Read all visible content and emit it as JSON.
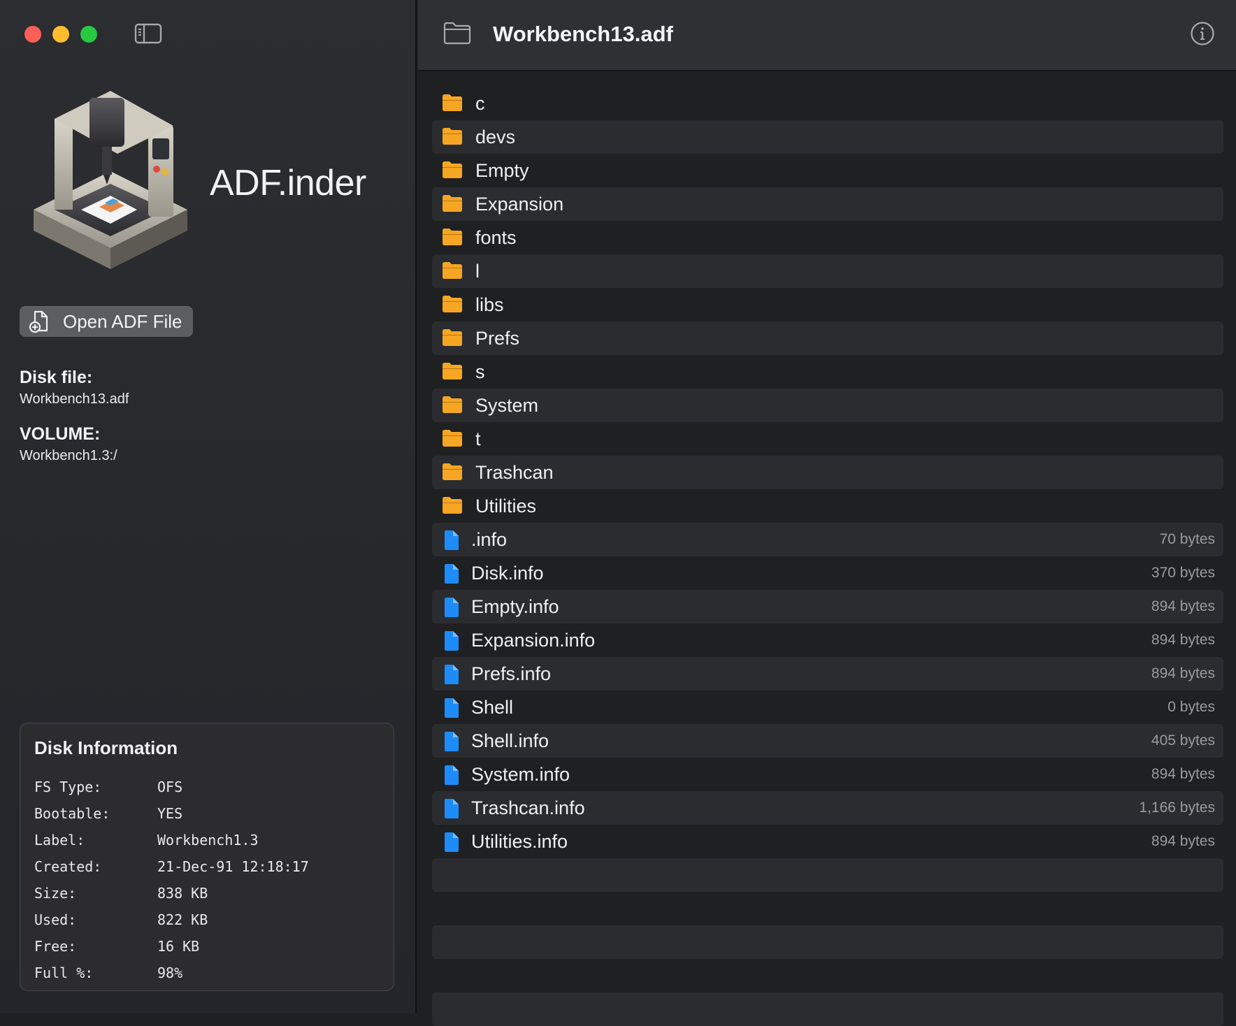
{
  "window": {
    "title": "Workbench13.adf"
  },
  "sidebar": {
    "app_name": "ADF.inder",
    "open_button_label": "Open ADF File",
    "disk_file_label": "Disk file:",
    "disk_file_value": "Workbench13.adf",
    "volume_label": "VOLUME:",
    "volume_value": "Workbench1.3:/"
  },
  "disk_info": {
    "title": "Disk Information",
    "rows": [
      {
        "key": "FS Type:",
        "value": "OFS"
      },
      {
        "key": "Bootable:",
        "value": "YES"
      },
      {
        "key": "Label:",
        "value": "Workbench1.3"
      },
      {
        "key": "Created:",
        "value": "21-Dec-91 12:18:17"
      },
      {
        "key": "Size:",
        "value": "838 KB"
      },
      {
        "key": "Used:",
        "value": "822 KB"
      },
      {
        "key": "Free:",
        "value": "16 KB"
      },
      {
        "key": "Full %:",
        "value": "98%"
      }
    ]
  },
  "files": [
    {
      "name": "c",
      "type": "folder",
      "size": ""
    },
    {
      "name": "devs",
      "type": "folder",
      "size": ""
    },
    {
      "name": "Empty",
      "type": "folder",
      "size": ""
    },
    {
      "name": "Expansion",
      "type": "folder",
      "size": ""
    },
    {
      "name": "fonts",
      "type": "folder",
      "size": ""
    },
    {
      "name": "l",
      "type": "folder",
      "size": ""
    },
    {
      "name": "libs",
      "type": "folder",
      "size": ""
    },
    {
      "name": "Prefs",
      "type": "folder",
      "size": ""
    },
    {
      "name": "s",
      "type": "folder",
      "size": ""
    },
    {
      "name": "System",
      "type": "folder",
      "size": ""
    },
    {
      "name": "t",
      "type": "folder",
      "size": ""
    },
    {
      "name": "Trashcan",
      "type": "folder",
      "size": ""
    },
    {
      "name": "Utilities",
      "type": "folder",
      "size": ""
    },
    {
      "name": ".info",
      "type": "file",
      "size": "70 bytes"
    },
    {
      "name": "Disk.info",
      "type": "file",
      "size": "370 bytes"
    },
    {
      "name": "Empty.info",
      "type": "file",
      "size": "894 bytes"
    },
    {
      "name": "Expansion.info",
      "type": "file",
      "size": "894 bytes"
    },
    {
      "name": "Prefs.info",
      "type": "file",
      "size": "894 bytes"
    },
    {
      "name": "Shell",
      "type": "file",
      "size": "0 bytes"
    },
    {
      "name": "Shell.info",
      "type": "file",
      "size": "405 bytes"
    },
    {
      "name": "System.info",
      "type": "file",
      "size": "894 bytes"
    },
    {
      "name": "Trashcan.info",
      "type": "file",
      "size": "1,166 bytes"
    },
    {
      "name": "Utilities.info",
      "type": "file",
      "size": "894 bytes"
    }
  ],
  "icons": {
    "close": "close-dot-icon",
    "minimize": "minimize-dot-icon",
    "zoom": "zoom-dot-icon",
    "sidebar_toggle": "sidebar-toggle-icon",
    "folder": "folder-icon",
    "file": "document-icon",
    "info": "info-circle-icon",
    "open_file": "document-add-icon"
  },
  "colors": {
    "accent_folder": "#f6a623",
    "accent_file": "#1d8cf8",
    "close": "#ff5f57",
    "minimize": "#febc2e",
    "zoom": "#28c840"
  }
}
